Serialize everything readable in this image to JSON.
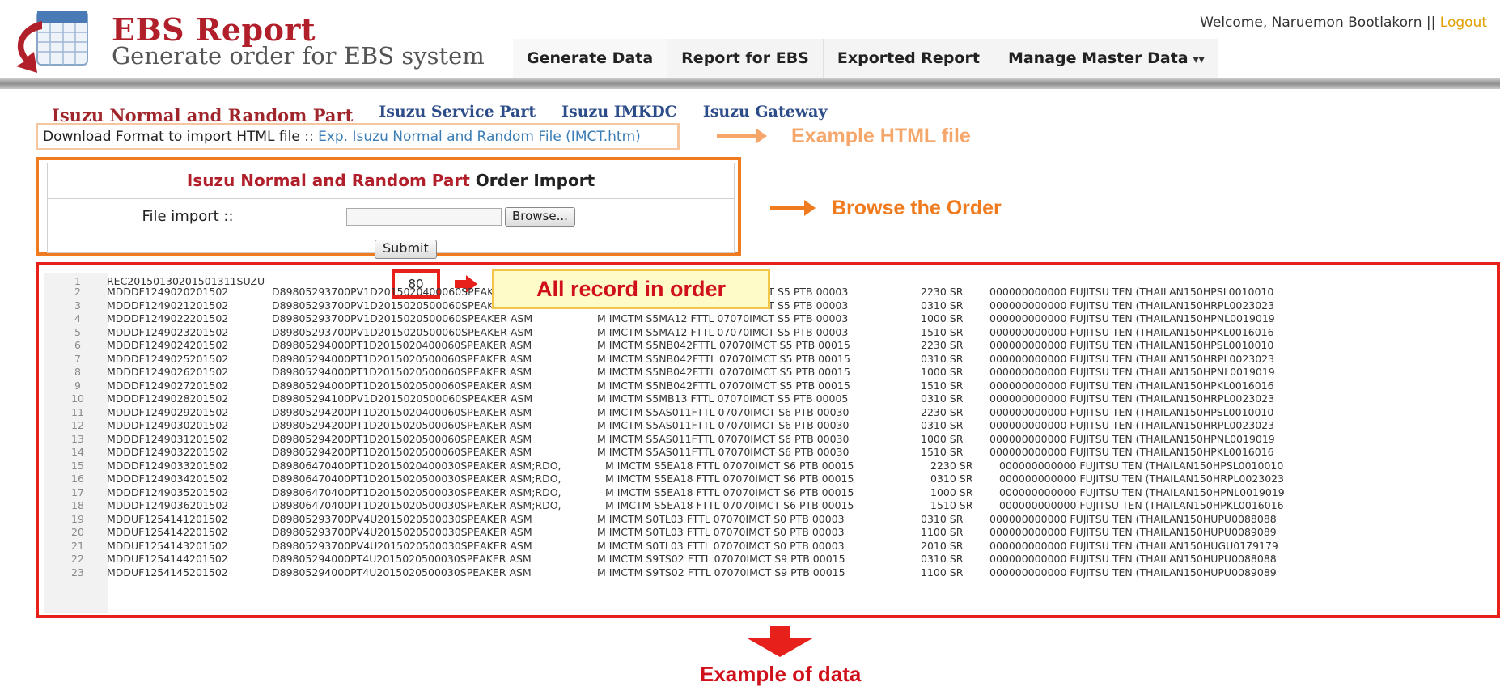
{
  "header": {
    "title": "EBS Report",
    "subtitle": "Generate order for EBS system",
    "welcome_text": "Welcome, Naruemon Bootlakorn ||",
    "logout_label": "Logout",
    "logo_icon": "spreadsheet-arrow-icon"
  },
  "nav": {
    "items": [
      {
        "label": "Generate Data"
      },
      {
        "label": "Report for EBS"
      },
      {
        "label": "Exported Report"
      },
      {
        "label": "Manage Master Data",
        "icon": "chevron-down-icon"
      }
    ]
  },
  "subtabs": [
    {
      "label": "Isuzu Normal and Random Part",
      "active": true
    },
    {
      "label": "Isuzu Service Part"
    },
    {
      "label": "Isuzu IMKDC"
    },
    {
      "label": "Isuzu Gateway"
    }
  ],
  "download": {
    "prefix": "Download Format to import HTML file ::",
    "link": "Exp. Isuzu Normal and Random File (IMCT.htm)"
  },
  "import_form": {
    "title_red": "Isuzu Normal and Random Part",
    "title_black": "Order Import",
    "file_label": "File import ::",
    "browse_label": "Browse...",
    "submit_label": "Submit"
  },
  "annotations": {
    "example_html": "Example HTML file",
    "browse_order": "Browse the Order",
    "all_record": "All record in order",
    "example_data": "Example of data"
  },
  "data": {
    "record_count": "80",
    "first_line": {
      "num": "1",
      "text": "REC20150130201501311SUZU"
    },
    "rows": [
      {
        "num": "2",
        "a": "MDDDF1249020201502",
        "b": "D89805293700PV1D2015020400060SPEAKER ASM",
        "c": "M IMCTM S5MA12 FTTL  07070IMCT  S5 PTB  00003",
        "d": "2230 SR",
        "e": "000000000000 FUJITSU TEN (THAILAN150HPSL0010010",
        "wide": false
      },
      {
        "num": "3",
        "a": "MDDDF1249021201502",
        "b": "D89805293700PV1D2015020500060SPEAKER ASM",
        "c": "M IMCTM S5MA12 FTTL  07070IMCT  S5 PTB  00003",
        "d": "0310 SR",
        "e": "000000000000 FUJITSU TEN (THAILAN150HRPL0023023",
        "wide": false
      },
      {
        "num": "4",
        "a": "MDDDF1249022201502",
        "b": "D89805293700PV1D2015020500060SPEAKER ASM",
        "c": "M IMCTM S5MA12 FTTL  07070IMCT  S5 PTB  00003",
        "d": "1000 SR",
        "e": "000000000000 FUJITSU TEN (THAILAN150HPNL0019019",
        "wide": false
      },
      {
        "num": "5",
        "a": "MDDDF1249023201502",
        "b": "D89805293700PV1D2015020500060SPEAKER ASM",
        "c": "M IMCTM S5MA12 FTTL  07070IMCT  S5 PTB  00003",
        "d": "1510 SR",
        "e": "000000000000 FUJITSU TEN (THAILAN150HPKL0016016",
        "wide": false
      },
      {
        "num": "6",
        "a": "MDDDF1249024201502",
        "b": "D89805294000PT1D2015020400060SPEAKER ASM",
        "c": "M IMCTM S5NB042FTTL  07070IMCT  S5 PTB  00015",
        "d": "2230 SR",
        "e": "000000000000 FUJITSU TEN (THAILAN150HPSL0010010",
        "wide": false
      },
      {
        "num": "7",
        "a": "MDDDF1249025201502",
        "b": "D89805294000PT1D2015020500060SPEAKER ASM",
        "c": "M IMCTM S5NB042FTTL  07070IMCT  S5 PTB  00015",
        "d": "0310 SR",
        "e": "000000000000 FUJITSU TEN (THAILAN150HRPL0023023",
        "wide": false
      },
      {
        "num": "8",
        "a": "MDDDF1249026201502",
        "b": "D89805294000PT1D2015020500060SPEAKER ASM",
        "c": "M IMCTM S5NB042FTTL  07070IMCT  S5 PTB  00015",
        "d": "1000 SR",
        "e": "000000000000 FUJITSU TEN (THAILAN150HPNL0019019",
        "wide": false
      },
      {
        "num": "9",
        "a": "MDDDF1249027201502",
        "b": "D89805294000PT1D2015020500060SPEAKER ASM",
        "c": "M IMCTM S5NB042FTTL  07070IMCT  S5 PTB  00015",
        "d": "1510 SR",
        "e": "000000000000 FUJITSU TEN (THAILAN150HPKL0016016",
        "wide": false
      },
      {
        "num": "10",
        "a": "MDDDF1249028201502",
        "b": "D89805294100PV1D2015020500060SPEAKER ASM",
        "c": "M IMCTM S5MB13 FTTL  07070IMCT  S5 PTB  00005",
        "d": "0310 SR",
        "e": "000000000000 FUJITSU TEN (THAILAN150HRPL0023023",
        "wide": false
      },
      {
        "num": "11",
        "a": "MDDDF1249029201502",
        "b": "D89805294200PT1D2015020400060SPEAKER ASM",
        "c": "M IMCTM S5AS011FTTL  07070IMCT  S6 PTB  00030",
        "d": "2230 SR",
        "e": "000000000000 FUJITSU TEN (THAILAN150HPSL0010010",
        "wide": false
      },
      {
        "num": "12",
        "a": "MDDDF1249030201502",
        "b": "D89805294200PT1D2015020500060SPEAKER ASM",
        "c": "M IMCTM S5AS011FTTL  07070IMCT  S6 PTB  00030",
        "d": "0310 SR",
        "e": "000000000000 FUJITSU TEN (THAILAN150HRPL0023023",
        "wide": false
      },
      {
        "num": "13",
        "a": "MDDDF1249031201502",
        "b": "D89805294200PT1D2015020500060SPEAKER ASM",
        "c": "M IMCTM S5AS011FTTL  07070IMCT  S6 PTB  00030",
        "d": "1000 SR",
        "e": "000000000000 FUJITSU TEN (THAILAN150HPNL0019019",
        "wide": false
      },
      {
        "num": "14",
        "a": "MDDDF1249032201502",
        "b": "D89805294200PT1D2015020500060SPEAKER ASM",
        "c": "M IMCTM S5AS011FTTL  07070IMCT  S6 PTB  00030",
        "d": "1510 SR",
        "e": "000000000000 FUJITSU TEN (THAILAN150HPKL0016016",
        "wide": false
      },
      {
        "num": "15",
        "a": "MDDDF1249033201502",
        "b": "D89806470400PT1D2015020400030SPEAKER ASM;RDO,",
        "c": "M IMCTM S5EA18 FTTL  07070IMCT  S6 PTB  00015",
        "d": "2230 SR",
        "e": "000000000000 FUJITSU TEN (THAILAN150HPSL0010010",
        "wide": true
      },
      {
        "num": "16",
        "a": "MDDDF1249034201502",
        "b": "D89806470400PT1D2015020500030SPEAKER ASM;RDO,",
        "c": "M IMCTM S5EA18 FTTL  07070IMCT  S6 PTB  00015",
        "d": "0310 SR",
        "e": "000000000000 FUJITSU TEN (THAILAN150HRPL0023023",
        "wide": true
      },
      {
        "num": "17",
        "a": "MDDDF1249035201502",
        "b": "D89806470400PT1D2015020500030SPEAKER ASM;RDO,",
        "c": "M IMCTM S5EA18 FTTL  07070IMCT  S6 PTB  00015",
        "d": "1000 SR",
        "e": "000000000000 FUJITSU TEN (THAILAN150HPNL0019019",
        "wide": true
      },
      {
        "num": "18",
        "a": "MDDDF1249036201502",
        "b": "D89806470400PT1D2015020500030SPEAKER ASM;RDO,",
        "c": "M IMCTM S5EA18 FTTL  07070IMCT  S6 PTB  00015",
        "d": "1510 SR",
        "e": "000000000000 FUJITSU TEN (THAILAN150HPKL0016016",
        "wide": true
      },
      {
        "num": "19",
        "a": "MDDUF1254141201502",
        "b": "D89805293700PV4U2015020500030SPEAKER ASM",
        "c": "M IMCTM S0TL03 FTTL  07070IMCT  S0 PTB  00003",
        "d": "0310 SR",
        "e": "000000000000 FUJITSU TEN (THAILAN150HUPU0088088",
        "wide": false
      },
      {
        "num": "20",
        "a": "MDDUF1254142201502",
        "b": "D89805293700PV4U2015020500030SPEAKER ASM",
        "c": "M IMCTM S0TL03 FTTL  07070IMCT  S0 PTB  00003",
        "d": "1100 SR",
        "e": "000000000000 FUJITSU TEN (THAILAN150HUPU0089089",
        "wide": false
      },
      {
        "num": "21",
        "a": "MDDUF1254143201502",
        "b": "D89805293700PV4U2015020500030SPEAKER ASM",
        "c": "M IMCTM S0TL03 FTTL  07070IMCT  S0 PTB  00003",
        "d": "2010 SR",
        "e": "000000000000 FUJITSU TEN (THAILAN150HUGU0179179",
        "wide": false
      },
      {
        "num": "22",
        "a": "MDDUF1254144201502",
        "b": "D89805294000PT4U2015020500030SPEAKER ASM",
        "c": "M IMCTM S9TS02 FTTL  07070IMCT  S9 PTB  00015",
        "d": "0310 SR",
        "e": "000000000000 FUJITSU TEN (THAILAN150HUPU0088088",
        "wide": false
      },
      {
        "num": "23",
        "a": "MDDUF1254145201502",
        "b": "D89805294000PT4U2015020500030SPEAKER ASM",
        "c": "M IMCTM S9TS02 FTTL  07070IMCT  S9 PTB  00015",
        "d": "1100 SR",
        "e": "000000000000 FUJITSU TEN (THAILAN150HUPU0089089",
        "wide": false
      }
    ]
  },
  "colors": {
    "brand_red": "#b1202a",
    "annotation_orange": "#f07b1e",
    "annotation_light_orange": "#f5a76b",
    "highlight_red": "#e8201c",
    "link_blue": "#3a7db5"
  }
}
